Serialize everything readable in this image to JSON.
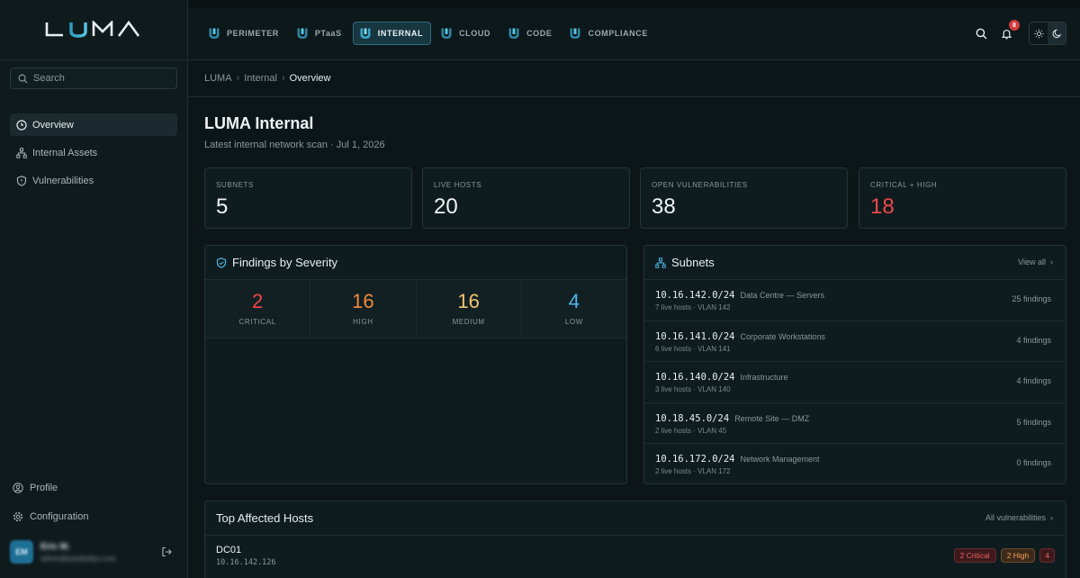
{
  "app": {
    "logo_text": "LUMA",
    "colors": {
      "accent": "#2f9fc0",
      "critical": "#ef4747",
      "high": "#f08a3c",
      "medium": "#f2c46d",
      "low": "#4fb8e6"
    }
  },
  "sidebar": {
    "search_placeholder": "Search",
    "items": [
      {
        "label": "Overview",
        "icon": "clock-icon",
        "active": true
      },
      {
        "label": "Internal Assets",
        "icon": "network-icon",
        "active": false
      },
      {
        "label": "Vulnerabilities",
        "icon": "shield-icon",
        "active": false
      }
    ],
    "bottom": [
      {
        "label": "Profile",
        "icon": "user-icon"
      },
      {
        "label": "Configuration",
        "icon": "gear-icon"
      }
    ],
    "user": {
      "initials": "EM",
      "name": "Eric M.",
      "email": "admin@parabellyx.com"
    }
  },
  "topbar": {
    "tabs": [
      {
        "label": "PERIMETER",
        "active": false
      },
      {
        "label": "PTaaS",
        "active": false
      },
      {
        "label": "INTERNAL",
        "active": true
      },
      {
        "label": "CLOUD",
        "active": false
      },
      {
        "label": "CODE",
        "active": false
      },
      {
        "label": "COMPLIANCE",
        "active": false
      }
    ],
    "notification_count": "8"
  },
  "breadcrumb": {
    "root": "LUMA",
    "section": "Internal",
    "current": "Overview"
  },
  "page": {
    "title": "LUMA Internal",
    "subtitle": "Latest internal network scan · Jul 1, 2026"
  },
  "stats": [
    {
      "label": "SUBNETS",
      "value": "5"
    },
    {
      "label": "LIVE HOSTS",
      "value": "20"
    },
    {
      "label": "OPEN VULNERABILITIES",
      "value": "38"
    },
    {
      "label": "CRITICAL + HIGH",
      "value": "18"
    }
  ],
  "severity": {
    "title": "Findings by Severity",
    "cells": [
      {
        "value": "2",
        "label": "CRITICAL"
      },
      {
        "value": "16",
        "label": "HIGH"
      },
      {
        "value": "16",
        "label": "MEDIUM"
      },
      {
        "value": "4",
        "label": "LOW"
      }
    ]
  },
  "subnets": {
    "title": "Subnets",
    "view_all": "View all",
    "rows": [
      {
        "cidr": "10.16.142.0/24",
        "desc": "Data Centre — Servers",
        "meta": "7 live hosts · VLAN 142",
        "count": "25 findings"
      },
      {
        "cidr": "10.16.141.0/24",
        "desc": "Corporate Workstations",
        "meta": "6 live hosts · VLAN 141",
        "count": "4 findings"
      },
      {
        "cidr": "10.16.140.0/24",
        "desc": "Infrastructure",
        "meta": "3 live hosts · VLAN 140",
        "count": "4 findings"
      },
      {
        "cidr": "10.18.45.0/24",
        "desc": "Remote Site — DMZ",
        "meta": "2 live hosts · VLAN 45",
        "count": "5 findings"
      },
      {
        "cidr": "10.16.172.0/24",
        "desc": "Network Management",
        "meta": "2 live hosts · VLAN 172",
        "count": "0 findings"
      }
    ]
  },
  "hosts": {
    "title": "Top Affected Hosts",
    "link": "All vulnerabilities",
    "rows": [
      {
        "name": "DC01",
        "ip": "10.16.142.126",
        "critical": "2 Critical",
        "high": "2 High",
        "total": "4"
      }
    ]
  }
}
